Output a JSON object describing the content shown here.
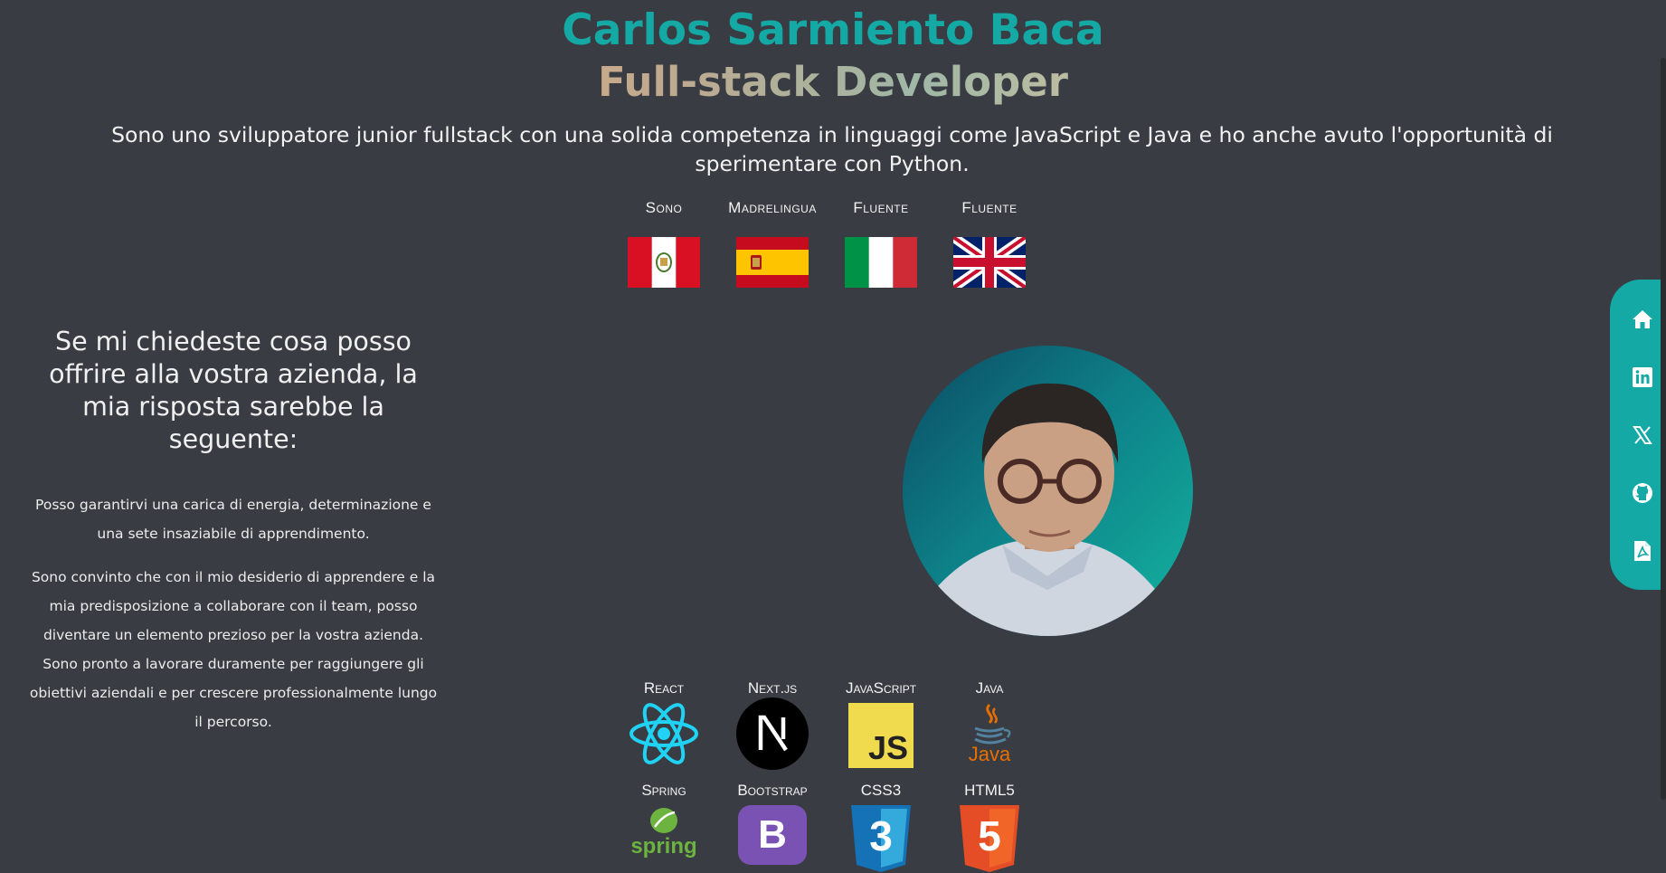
{
  "header": {
    "name": "Carlos Sarmiento Baca",
    "role": "Full-stack Developer"
  },
  "intro": "Sono uno sviluppatore junior fullstack con una solida competenza in linguaggi come JavaScript e Java e ho anche avuto l'opportunità di sperimentare con Python.",
  "languages": [
    {
      "label": "Sono",
      "flag": "peru-flag"
    },
    {
      "label": "Madrelingua",
      "flag": "spain-flag"
    },
    {
      "label": "Fluente",
      "flag": "italy-flag"
    },
    {
      "label": "Fluente",
      "flag": "uk-flag"
    }
  ],
  "pitch": {
    "title": "Se mi chiedeste cosa posso offrire alla vostra azienda, la mia risposta sarebbe la seguente:",
    "p1": "Posso garantirvi una carica di energia, determinazione e una sete insaziabile di apprendimento.",
    "p2": "Sono convinto che con il mio desiderio di apprendere e la mia predisposizione a collaborare con il team, posso diventare un elemento prezioso per la vostra azienda. Sono pronto a lavorare duramente per raggiungere gli obiettivi aziendali e per crescere professionalmente lungo il percorso."
  },
  "tech": [
    {
      "label": "React",
      "icon": "react-icon"
    },
    {
      "label": "Next.js",
      "icon": "nextjs-icon"
    },
    {
      "label": "JavaScript",
      "icon": "javascript-icon",
      "text": "JS"
    },
    {
      "label": "Java",
      "icon": "java-icon",
      "text": "Java"
    },
    {
      "label": "Spring",
      "icon": "spring-icon",
      "text": "spring"
    },
    {
      "label": "Bootstrap",
      "icon": "bootstrap-icon",
      "text": "B"
    },
    {
      "label": "CSS3",
      "icon": "css3-icon",
      "text": "3"
    },
    {
      "label": "HTML5",
      "icon": "html5-icon",
      "text": "5"
    }
  ],
  "social": [
    "home-icon",
    "linkedin-icon",
    "x-icon",
    "github-icon",
    "pdf-icon"
  ],
  "colors": {
    "background": "#393c42",
    "accent": "#14a9a4"
  }
}
